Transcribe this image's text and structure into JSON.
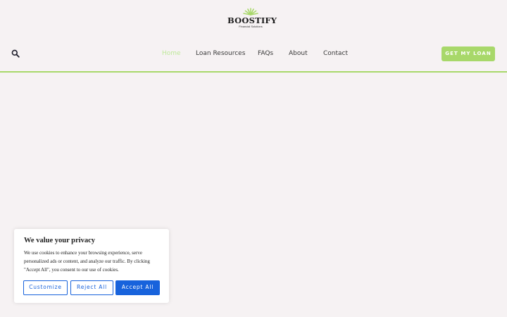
{
  "brand": {
    "name": "BOOSTIFY",
    "tagline": "Financial Solutions",
    "accent_color": "#a8d86a"
  },
  "header": {
    "search_icon": "search-icon",
    "nav": [
      {
        "label": "Home",
        "active": true
      },
      {
        "label": "Loan Resources",
        "active": false
      },
      {
        "label": "FAQs",
        "active": false
      },
      {
        "label": "About",
        "active": false
      },
      {
        "label": "Contact",
        "active": false
      }
    ],
    "cta_label": "GET MY LOAN"
  },
  "cookie_banner": {
    "title": "We value your privacy",
    "text": "We use cookies to enhance your browsing experience, serve personalized ads or content, and analyze our traffic. By clicking \"Accept All\", you consent to our use of cookies.",
    "customize_label": "Customize",
    "reject_label": "Reject All",
    "accept_label": "Accept All",
    "button_color": "#1863dc"
  }
}
